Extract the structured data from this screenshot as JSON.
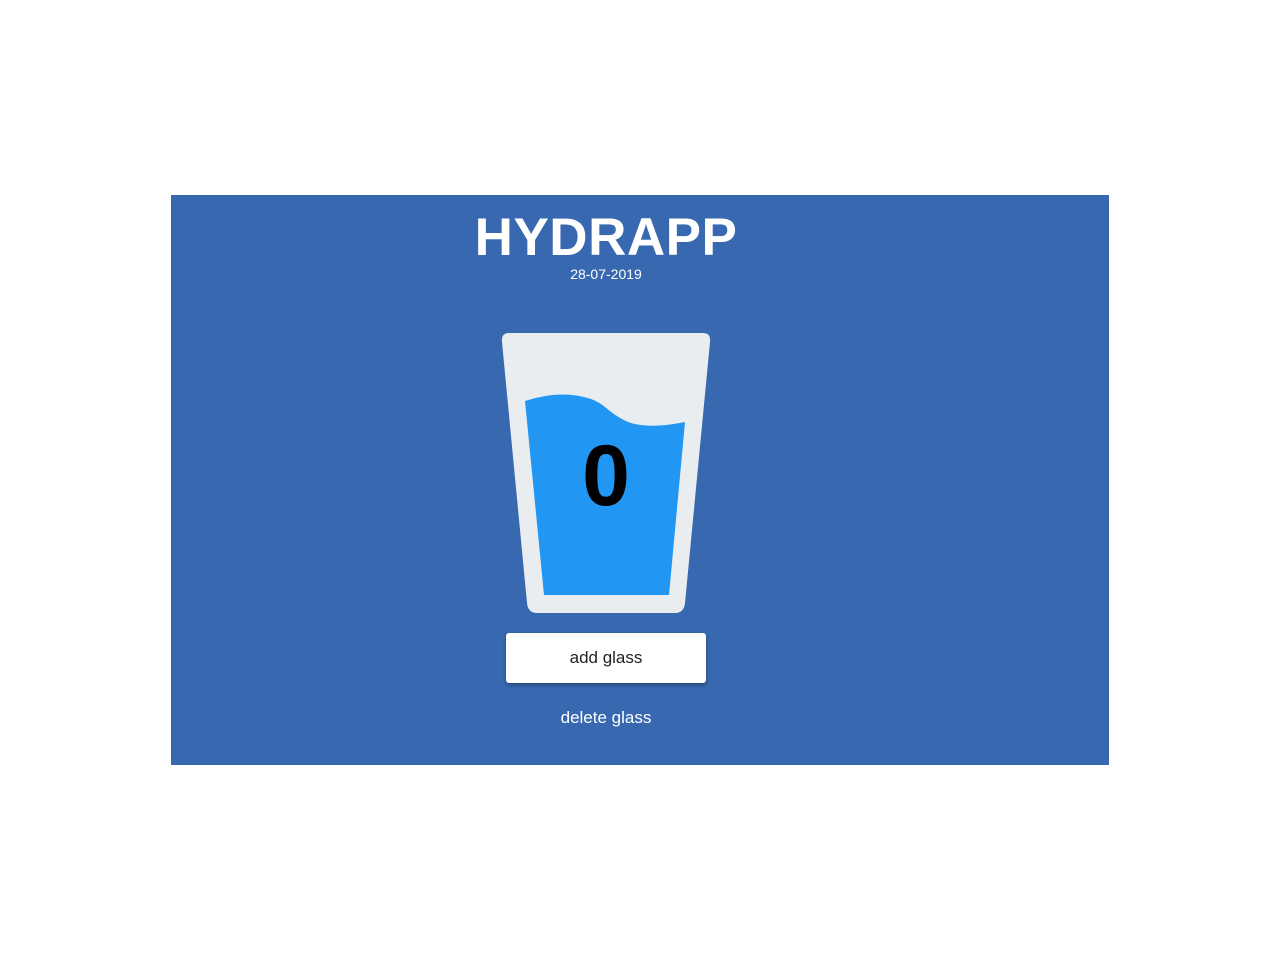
{
  "app": {
    "title": "HYDRAPP",
    "date": "28-07-2019"
  },
  "glass": {
    "count": "0",
    "icon": "water-glass-icon",
    "colors": {
      "glass": "#e9edf0",
      "water": "#2196f3"
    }
  },
  "actions": {
    "add_label": "add glass",
    "delete_label": "delete glass"
  },
  "colors": {
    "panel_background": "#3869b0",
    "page_background": "#ffffff",
    "text": "#ffffff"
  }
}
